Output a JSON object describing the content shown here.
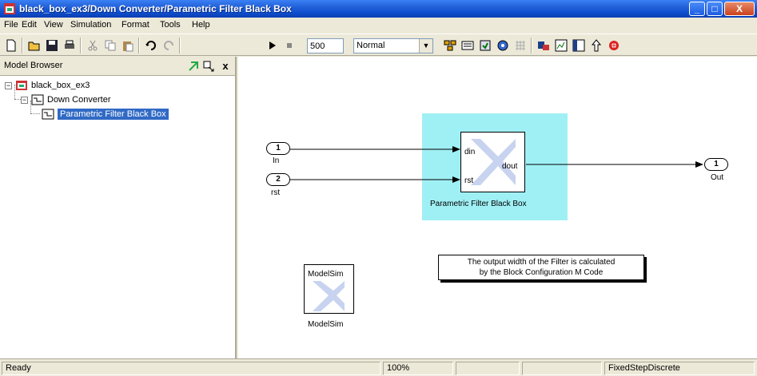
{
  "window": {
    "title": "black_box_ex3/Down Converter/Parametric Filter Black Box",
    "minimize": "_",
    "maximize": "□",
    "close": "X"
  },
  "menu": {
    "items": [
      "File",
      "Edit",
      "View",
      "Simulation",
      "Format",
      "Tools",
      "Help"
    ]
  },
  "toolbar": {
    "stop_time": "500",
    "sim_mode": "Normal",
    "icons": [
      "new-icon",
      "open-icon",
      "save-icon",
      "print-icon",
      "cut-icon",
      "copy-icon",
      "paste-icon",
      "undo-icon",
      "redo-icon",
      "play-icon",
      "stop-icon",
      "library-icon",
      "debug-icon",
      "update-icon",
      "build-icon",
      "grid-icon",
      "model-explorer-icon",
      "explorer-icon",
      "browser-icon",
      "go-parent-icon",
      "debugger-icon"
    ]
  },
  "browser": {
    "title": "Model Browser",
    "close": "x",
    "tree": [
      {
        "label": "black_box_ex3",
        "level": 0
      },
      {
        "label": "Down Converter",
        "level": 1
      },
      {
        "label": "Parametric Filter Black Box",
        "level": 2,
        "selected": true
      }
    ]
  },
  "canvas": {
    "inports": [
      {
        "number": "1",
        "label": "In"
      },
      {
        "number": "2",
        "label": "rst"
      }
    ],
    "outport": {
      "number": "1",
      "label": "Out"
    },
    "filter_block": {
      "caption": "Parametric Filter Black Box",
      "port_din": "din",
      "port_rst": "rst",
      "port_dout": "dout"
    },
    "note": {
      "line1": "The output width of the Filter is calculated",
      "line2": "by the Block Configuration M Code"
    },
    "modelsim": {
      "inner_label": "ModelSim",
      "caption": "ModelSim"
    }
  },
  "status": {
    "left": "Ready",
    "zoom": "100%",
    "solver": "FixedStepDiscrete"
  },
  "colors": {
    "title_bar": "#0f4fd0",
    "highlight": "#9ff0f5",
    "selection": "#316ac5"
  }
}
